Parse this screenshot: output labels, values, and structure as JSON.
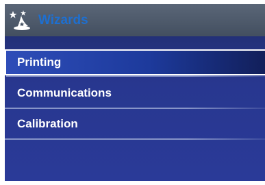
{
  "window": {
    "title": "Wizards",
    "icon": "wizard-hat-icon"
  },
  "menu": {
    "items": [
      {
        "label": "Printing",
        "selected": true
      },
      {
        "label": "Communications",
        "selected": false
      },
      {
        "label": "Calibration",
        "selected": false
      }
    ]
  },
  "colors": {
    "background": "#28378f",
    "titlebar": "#4e5a6b",
    "title_text": "#1e6fd0",
    "separator": "#8794c8",
    "selection_border": "#ffffff"
  }
}
